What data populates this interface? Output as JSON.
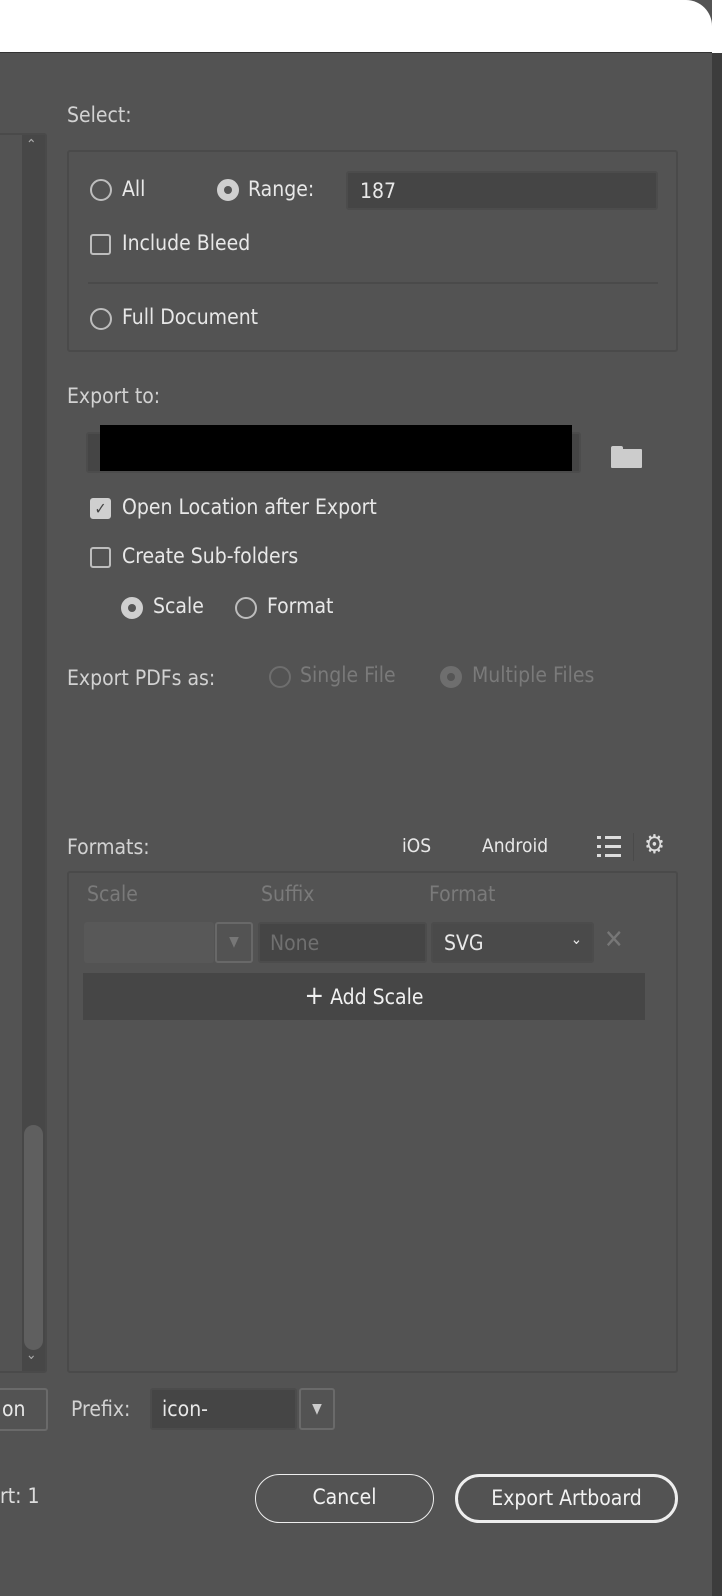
{
  "select": {
    "label": "Select:",
    "all": "All",
    "range": "Range:",
    "range_value": "187",
    "include_bleed": "Include Bleed",
    "full_document": "Full Document"
  },
  "export_to": {
    "label": "Export to:",
    "open_location": "Open Location after Export",
    "create_subfolders": "Create Sub-folders",
    "scale": "Scale",
    "format": "Format"
  },
  "export_pdfs": {
    "label": "Export PDFs as:",
    "single": "Single File",
    "multiple": "Multiple Files"
  },
  "formats": {
    "label": "Formats:",
    "ios": "iOS",
    "android": "Android",
    "col_scale": "Scale",
    "col_suffix": "Suffix",
    "col_format": "Format",
    "suffix_placeholder": "None",
    "format_value": "SVG",
    "add_scale": "Add Scale"
  },
  "bottom": {
    "left_button": "on",
    "prefix_label": "Prefix:",
    "prefix_value": "icon-",
    "count_text": "rt: 1",
    "cancel": "Cancel",
    "export": "Export Artboard"
  }
}
